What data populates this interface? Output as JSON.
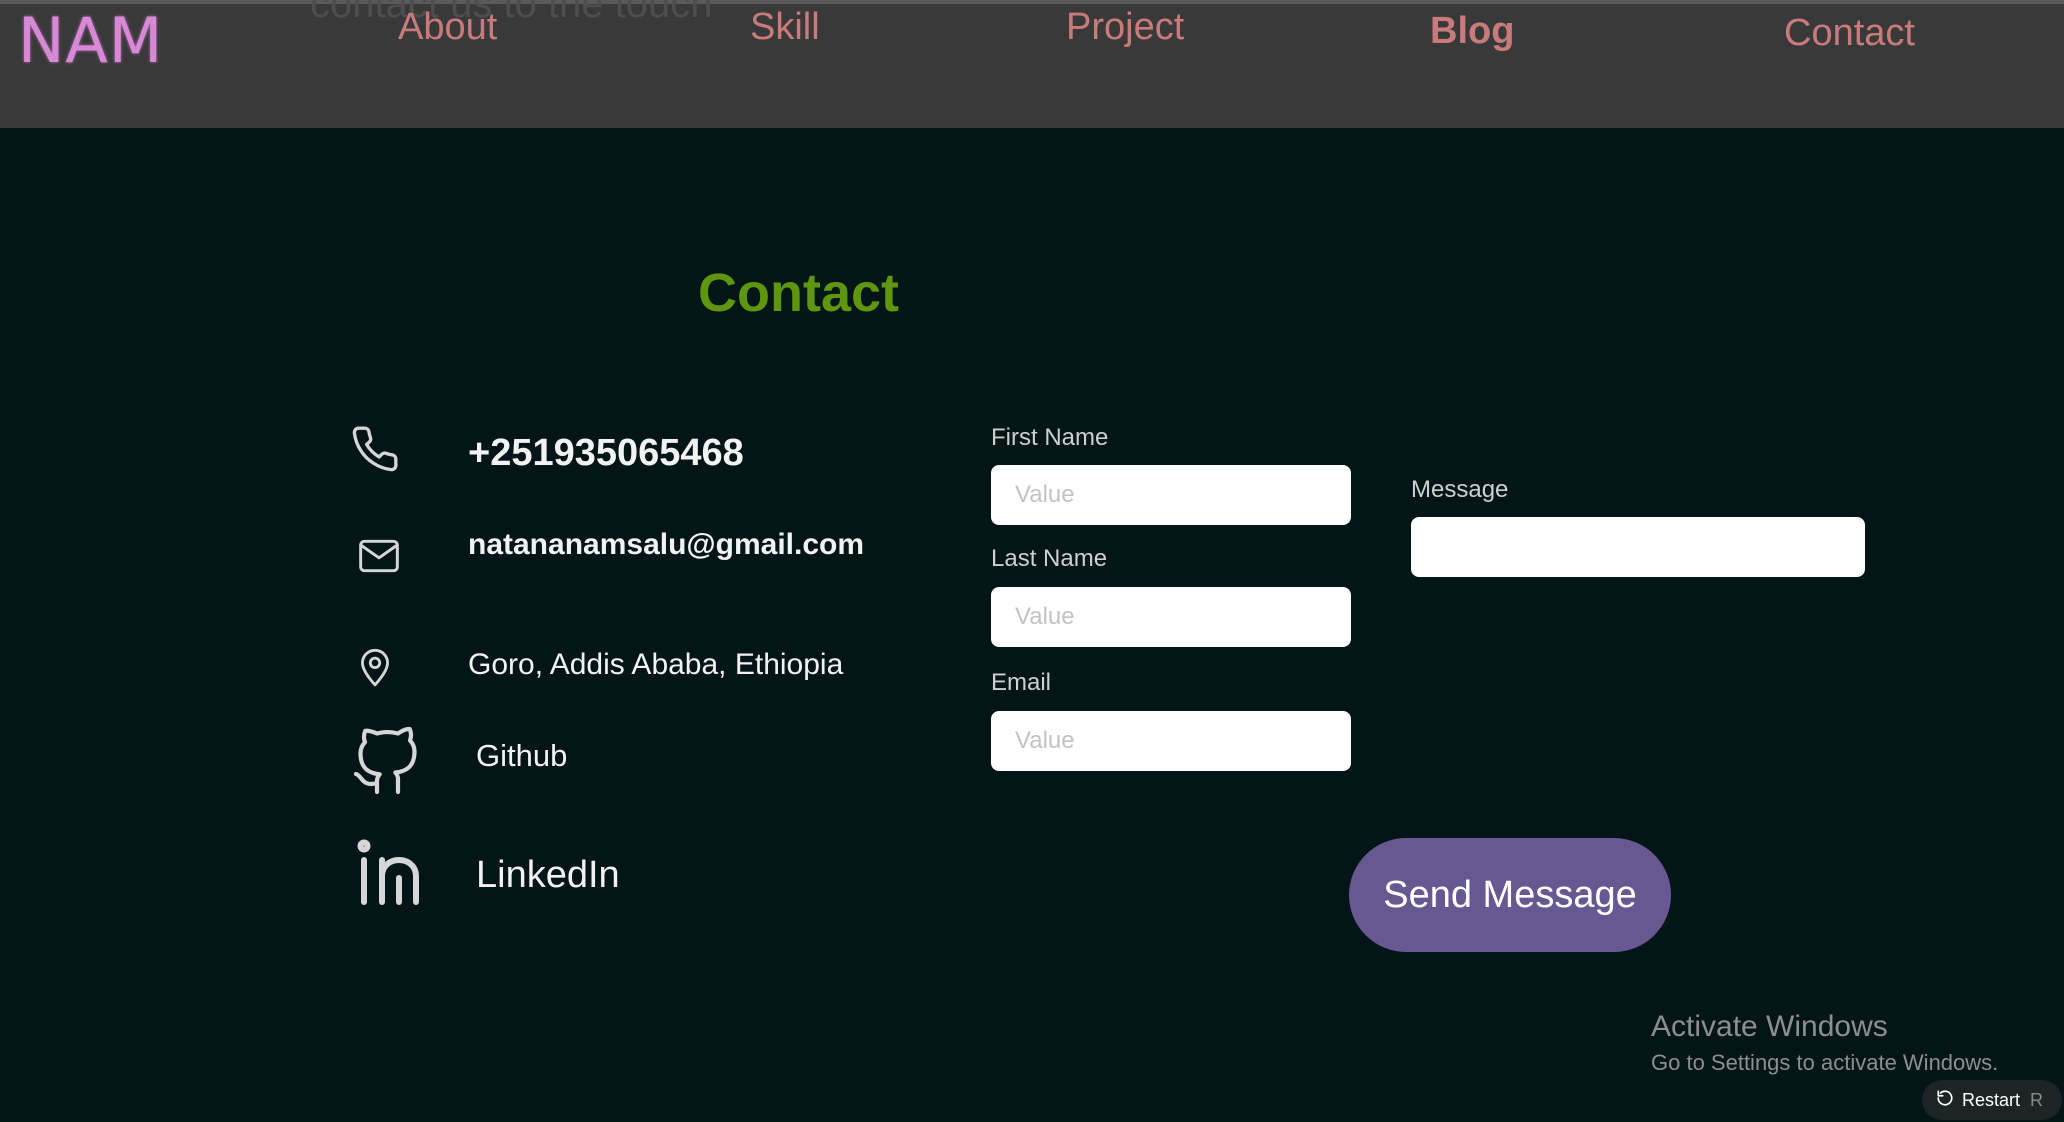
{
  "nav": {
    "logo": "NAM",
    "items": [
      {
        "label": "About"
      },
      {
        "label": "Skill"
      },
      {
        "label": "Project"
      },
      {
        "label": "Blog",
        "active": true
      },
      {
        "label": "Contact"
      }
    ]
  },
  "contact": {
    "title": "Contact",
    "info": {
      "phone": "+251935065468",
      "email": "natananamsalu@gmail.com",
      "location": "Goro, Addis Ababa, Ethiopia",
      "github": "Github",
      "linkedin": "LinkedIn"
    },
    "form": {
      "first_name": {
        "label": "First Name",
        "placeholder": "Value"
      },
      "last_name": {
        "label": "Last Name",
        "placeholder": "Value"
      },
      "email": {
        "label": "Email",
        "placeholder": "Value"
      },
      "message": {
        "label": "Message",
        "placeholder": ""
      },
      "submit": "Send Message"
    }
  },
  "windows_notice": {
    "title": "Activate Windows",
    "subtitle": "Go to Settings to activate Windows."
  },
  "restart": {
    "label": "Restart",
    "shortcut": "R"
  },
  "colors": {
    "background": "#031516",
    "navbar": "#393939",
    "nav_text": "#c97b7b",
    "logo": "#d889d6",
    "title": "#5f9610",
    "button": "#675892"
  },
  "icons": [
    "phone-icon",
    "mail-icon",
    "location-pin-icon",
    "github-icon",
    "linkedin-icon",
    "restart-icon"
  ]
}
